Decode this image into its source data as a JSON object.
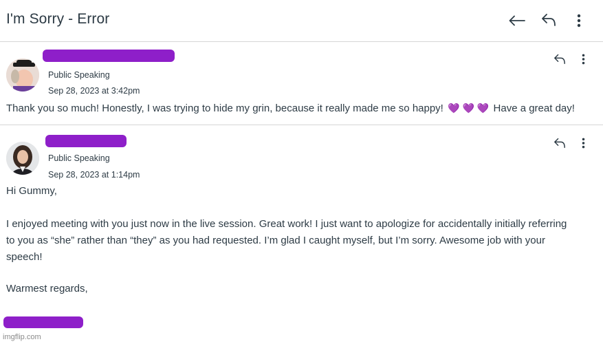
{
  "header": {
    "title": "I'm Sorry - Error",
    "back_icon": "arrow-left-icon",
    "reply_icon": "reply-icon",
    "more_icon": "kebab-menu-icon"
  },
  "messages": [
    {
      "course": "Public Speaking",
      "date": "Sep 28, 2023 at 3:42pm",
      "body_before": "Thank you so much! Honestly, I was trying to hide my grin, because it really made me so happy!",
      "hearts": [
        "💜",
        "💜",
        "💜"
      ],
      "body_after": "Have a great day!"
    },
    {
      "course": "Public Speaking",
      "date": "Sep 28, 2023 at 1:14pm",
      "greeting": "Hi Gummy,",
      "paragraph": [
        "I enjoyed meeting with you just now in the live session. Great work! I just want to apologize for accidentally initially referring",
        "to you as “she” rather than “they” as you had requested. I’m glad I caught myself, but I’m sorry. Awesome job with your",
        "speech!"
      ],
      "closing": "Warmest regards,"
    }
  ],
  "colors": {
    "redaction": "#8e1fc9",
    "heart": "#8a4bd6",
    "text": "#2d3b45"
  },
  "watermark": "imgflip.com"
}
